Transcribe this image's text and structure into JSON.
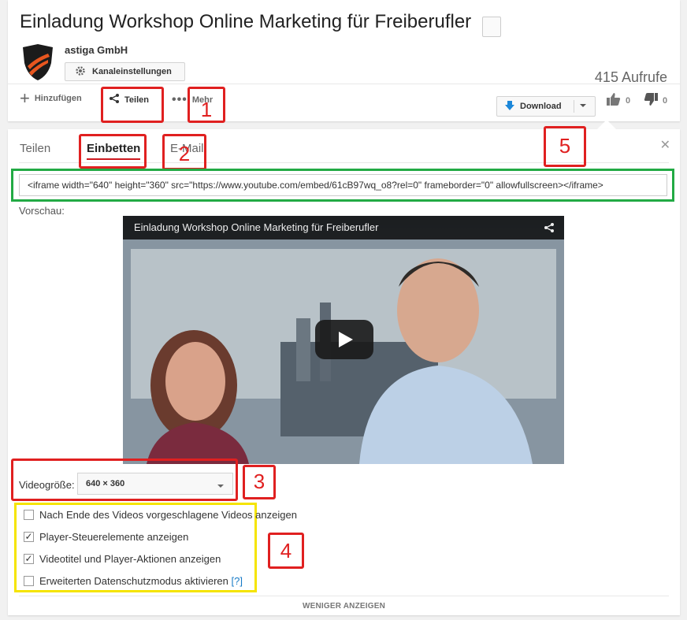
{
  "video": {
    "title": "Einladung Workshop Online Marketing für Freiberufler",
    "channel": "astiga GmbH",
    "views": "415 Aufrufe"
  },
  "buttons": {
    "channel_settings": "Kanaleinstellungen",
    "add": "Hinzufügen",
    "share": "Teilen",
    "more": "Mehr",
    "download": "Download",
    "like_count": "0",
    "dislike_count": "0"
  },
  "tabs": [
    {
      "label": "Teilen",
      "active": false
    },
    {
      "label": "Einbetten",
      "active": true
    },
    {
      "label": "E-Mail",
      "active": false
    }
  ],
  "embed": {
    "code": "<iframe width=\"640\" height=\"360\" src=\"https://www.youtube.com/embed/61cB97wq_o8?rel=0\" frameborder=\"0\" allowfullscreen></iframe>",
    "preview_label": "Vorschau:",
    "player_title": "Einladung Workshop Online Marketing für Freiberufler",
    "size_label": "Videogröße:",
    "size_value": "640 × 360"
  },
  "options": [
    {
      "label": "Nach Ende des Videos vorgeschlagene Videos anzeigen",
      "checked": false
    },
    {
      "label": "Player-Steuerelemente anzeigen",
      "checked": true
    },
    {
      "label": "Videotitel und Player-Aktionen anzeigen",
      "checked": true
    },
    {
      "label": "Erweiterten Datenschutzmodus aktivieren",
      "checked": false,
      "help": "[?]"
    }
  ],
  "show_less": "WENIGER ANZEIGEN",
  "annotations": [
    "1",
    "2",
    "3",
    "4",
    "5"
  ],
  "colors": {
    "annotation_red": "#e02020",
    "annotation_green": "#22aa44",
    "annotation_yellow": "#f5e400",
    "active_tab_underline": "#cc181e",
    "download_blue": "#1c87d9"
  }
}
